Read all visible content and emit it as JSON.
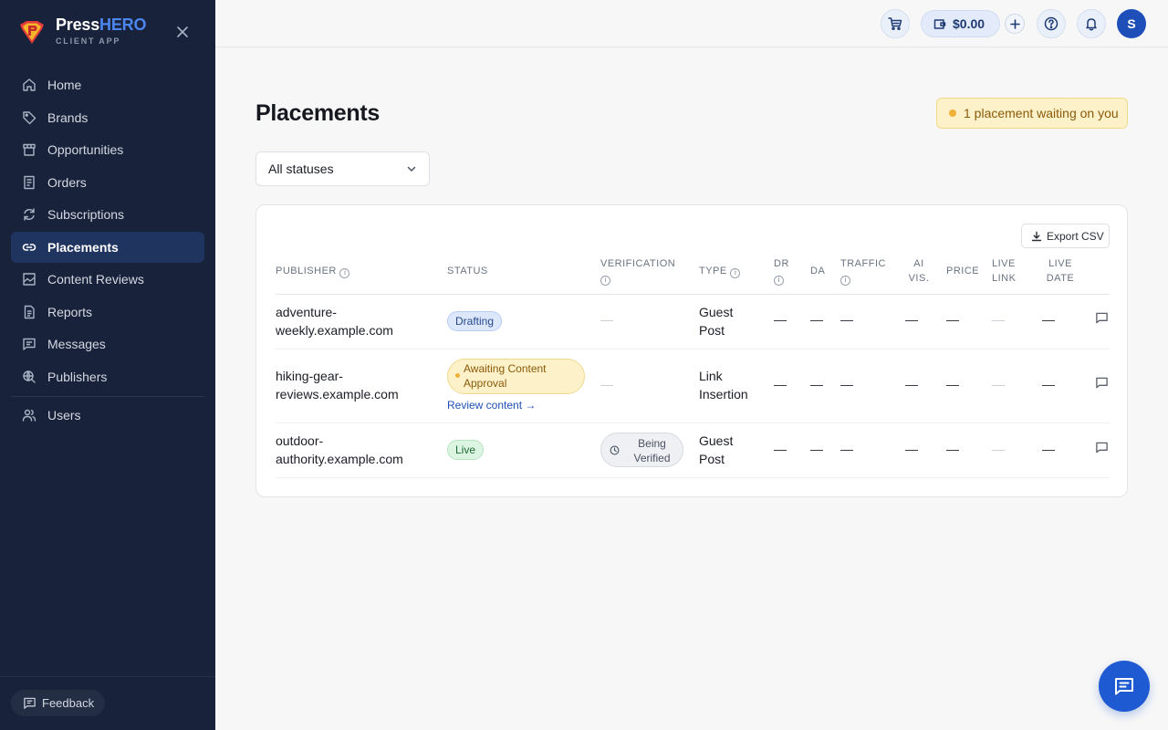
{
  "brand": {
    "name_part1": "Press",
    "name_part2": "HERO",
    "subtitle": "CLIENT APP"
  },
  "sidebar": {
    "items": [
      {
        "label": "Home",
        "icon": "home-icon",
        "active": false
      },
      {
        "label": "Brands",
        "icon": "tag-icon",
        "active": false
      },
      {
        "label": "Opportunities",
        "icon": "store-icon",
        "active": false
      },
      {
        "label": "Orders",
        "icon": "receipt-icon",
        "active": false
      },
      {
        "label": "Subscriptions",
        "icon": "refresh-icon",
        "active": false
      },
      {
        "label": "Placements",
        "icon": "link-icon",
        "active": true
      },
      {
        "label": "Content Reviews",
        "icon": "image-check-icon",
        "active": false
      },
      {
        "label": "Reports",
        "icon": "document-icon",
        "active": false
      },
      {
        "label": "Messages",
        "icon": "message-icon",
        "active": false
      },
      {
        "label": "Publishers",
        "icon": "globe-search-icon",
        "active": false
      }
    ],
    "admin_items": [
      {
        "label": "Users",
        "icon": "users-icon"
      }
    ],
    "feedback_label": "Feedback"
  },
  "topbar": {
    "wallet_balance": "$0.00",
    "avatar_initial": "S"
  },
  "main": {
    "title": "Placements",
    "waiting_badge": "1 placement waiting on you",
    "status_filter": "All statuses",
    "export_label": "Export CSV",
    "columns": {
      "publisher": "PUBLISHER",
      "status": "STATUS",
      "verification": "VERIFICATION",
      "type": "TYPE",
      "dr": "DR",
      "da": "DA",
      "traffic": "TRAFFIC",
      "ai_vis_1": "AI",
      "ai_vis_2": "VIS.",
      "price": "PRICE",
      "live_link_1": "LIVE",
      "live_link_2": "LINK",
      "live_date_1": "LIVE",
      "live_date_2": "DATE"
    },
    "rows": [
      {
        "publisher_1": "adventure-",
        "publisher_2": "weekly.example.com",
        "status": "Drafting",
        "verification": "—",
        "type_1": "Guest",
        "type_2": "Post",
        "dr": "—",
        "da": "—",
        "traffic": "—",
        "ai_vis": "—",
        "price": "—",
        "live_link": "—",
        "live_date": "—"
      },
      {
        "publisher_1": "hiking-gear-",
        "publisher_2": "reviews.example.com",
        "status": "Awaiting Content Approval",
        "status_action": "Review content →",
        "verification": "—",
        "type_1": "Link",
        "type_2": "Insertion",
        "dr": "—",
        "da": "—",
        "traffic": "—",
        "ai_vis": "—",
        "price": "—",
        "live_link": "—",
        "live_date": "—"
      },
      {
        "publisher_1": "outdoor-",
        "publisher_2": "authority.example.com",
        "status": "Live",
        "verification": "Being Verified",
        "type_1": "Guest",
        "type_2": "Post",
        "dr": "—",
        "da": "—",
        "traffic": "—",
        "ai_vis": "—",
        "price": "—",
        "live_link": "—",
        "live_date": "—"
      }
    ]
  },
  "colors": {
    "sidebar_bg": "#18223a",
    "active_nav_bg": "#1f3560",
    "brand_accent": "#4c86f0",
    "primary": "#1e5ad1"
  }
}
